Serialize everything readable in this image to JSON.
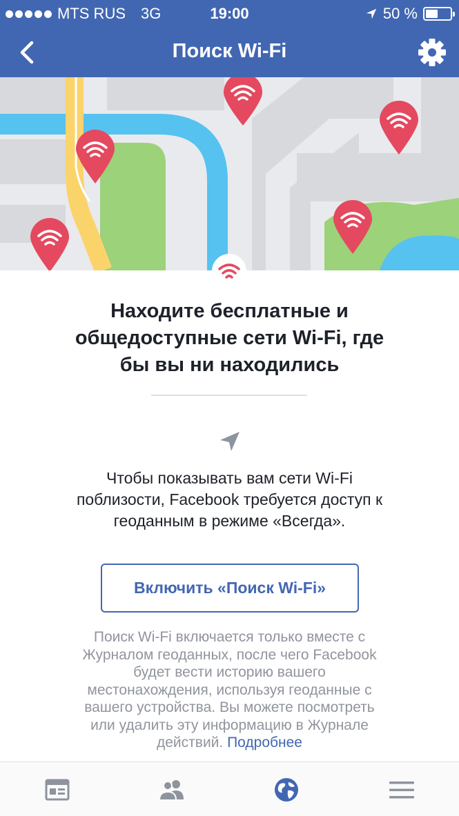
{
  "status_bar": {
    "carrier": "MTS RUS",
    "network": "3G",
    "time": "19:00",
    "battery": "50 %",
    "battery_level": 0.5,
    "signal_dots": 5
  },
  "nav_bar": {
    "title": "Поиск Wi-Fi",
    "back_icon": "chevron-left-icon",
    "settings_icon": "gear-icon"
  },
  "content": {
    "heading_lines": [
      "Находите бесплатные и",
      "общедоступные сети Wi-Fi, где",
      "бы вы ни находились"
    ],
    "description_lines": [
      "Чтобы показывать вам сети Wi-Fi",
      "поблизости, Facebook требуется доступ к",
      "геоданным в режиме «Всегда»."
    ],
    "enable_button": "Включить «Поиск Wi-Fi»",
    "footnote_lines": [
      "Поиск Wi-Fi включается только вместе с",
      "Журналом геоданных, после чего Facebook",
      "будет вести историю вашего",
      "местонахождения, используя геоданные с",
      "вашего устройства. Вы можете посмотреть",
      "или удалить эту информацию в Журнале",
      "действий."
    ],
    "learn_more": "Подробнее"
  },
  "tab_bar": {
    "tabs": [
      {
        "icon": "news-feed-icon",
        "active": false
      },
      {
        "icon": "friends-icon",
        "active": false
      },
      {
        "icon": "globe-icon",
        "active": true
      },
      {
        "icon": "menu-icon",
        "active": false
      }
    ]
  },
  "colors": {
    "brand": "#4267b2",
    "pin": "#e4495f",
    "map_water": "#55c2f0",
    "map_park": "#9bd27a",
    "map_road_yellow": "#fbd36b",
    "map_block": "#d8d9dd",
    "muted_text": "#90949c",
    "tab_inactive": "#8d949e"
  }
}
